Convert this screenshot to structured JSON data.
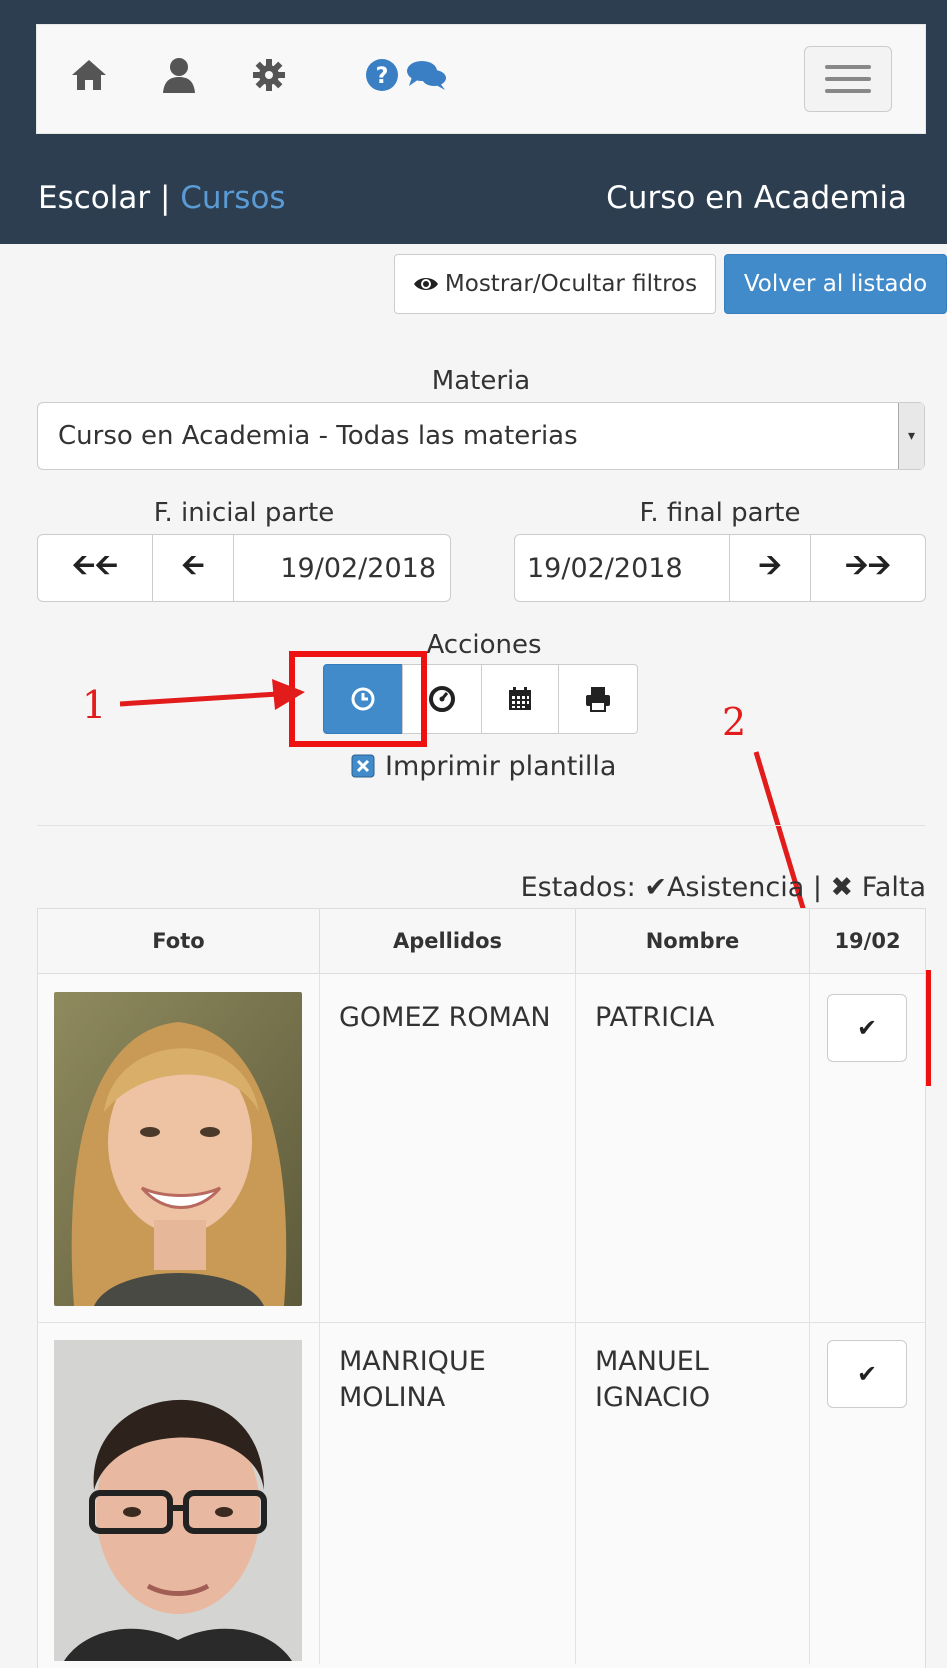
{
  "nav": {
    "icons": [
      "home-icon",
      "user-icon",
      "gear-icon",
      "help-icon",
      "chat-icon"
    ]
  },
  "breadcrumb": {
    "section": "Escolar",
    "separator": " | ",
    "link": "Cursos"
  },
  "page_title": "Curso en Academia",
  "toolbar": {
    "filters_label": "Mostrar/Ocultar filtros",
    "back_label": "Volver al listado"
  },
  "materia": {
    "label": "Materia",
    "selected": "Curso en Academia - Todas las materias"
  },
  "dates": {
    "start_label": "F. inicial parte",
    "start_value": "19/02/2018",
    "end_label": "F. final parte",
    "end_value": "19/02/2018"
  },
  "acciones": {
    "label": "Acciones",
    "print_template_label": "Imprimir plantilla"
  },
  "annotations": {
    "one": "1",
    "two": "2"
  },
  "legend": {
    "prefix": "Estados:",
    "attendance": "Asistencia",
    "separator": "|",
    "absence": "Falta"
  },
  "table": {
    "headers": [
      "Foto",
      "Apellidos",
      "Nombre",
      "19/02"
    ],
    "rows": [
      {
        "apellidos": "GOMEZ ROMAN",
        "nombre": "PATRICIA"
      },
      {
        "apellidos": "MANRIQUE MOLINA",
        "nombre": "MANUEL IGNACIO"
      }
    ]
  },
  "colors": {
    "header_bg": "#2c3e50",
    "primary": "#428bca",
    "link": "#5b9bd5",
    "annotation": "#e21b1b"
  }
}
